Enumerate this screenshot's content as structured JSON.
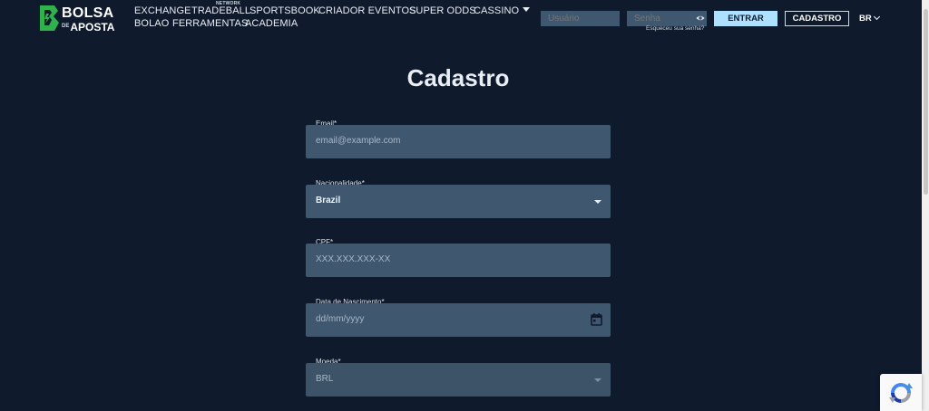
{
  "header": {
    "logo": {
      "line1": "BOLSA",
      "line2_small": "DE",
      "line2": "APOSTA"
    },
    "network_badge": "NETWORK",
    "nav": [
      {
        "label": "EXCHANGE"
      },
      {
        "label": "TRADEBALL"
      },
      {
        "label": "SPORTSBOOK"
      },
      {
        "label": "CRIADOR EVENTOS"
      },
      {
        "label": "SUPER ODDS"
      },
      {
        "label": "CASSINO"
      },
      {
        "label": "BOLAO"
      },
      {
        "label": "FERRAMENTAS"
      },
      {
        "label": "ACADEMIA"
      }
    ],
    "username_placeholder": "Usuário",
    "password_placeholder": "Senha",
    "forgot_password": "Esqueceu sua senha?",
    "login_button": "ENTRAR",
    "register_button": "CADASTRO",
    "language": "BR"
  },
  "page": {
    "title": "Cadastro"
  },
  "form": {
    "email": {
      "label": "Email*",
      "placeholder": "email@example.com"
    },
    "nationality": {
      "label": "Nacionalidade*",
      "value": "Brazil"
    },
    "cpf": {
      "label": "CPF*",
      "placeholder": "XXX.XXX.XXX-XX"
    },
    "birthdate": {
      "label": "Data de Nascimento*",
      "placeholder": "dd/mm/yyyy"
    },
    "currency": {
      "label": "Moeda*",
      "value": "BRL"
    }
  },
  "colors": {
    "background": "#0f1a2d",
    "field": "#3f5870",
    "accent_button": "#aee1ff",
    "logo_green": "#2fb24c"
  }
}
